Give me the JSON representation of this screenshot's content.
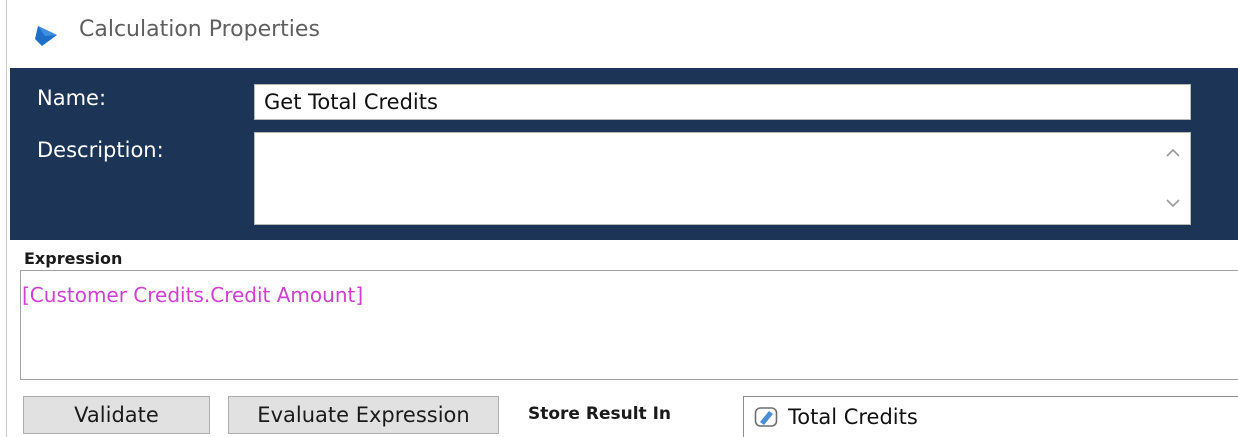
{
  "window": {
    "title": "Calculation Properties",
    "icon": "app-logo-icon"
  },
  "header": {
    "name_label": "Name:",
    "name_value": "Get Total Credits",
    "description_label": "Description:",
    "description_value": "",
    "background_color": "#1c3557"
  },
  "expression": {
    "label": "Expression",
    "value": "[Customer Credits.Credit Amount]",
    "text_color": "#d13ed3"
  },
  "actions": {
    "validate_label": "Validate",
    "evaluate_label": "Evaluate Expression"
  },
  "store": {
    "label": "Store Result In",
    "value": "Total Credits",
    "icon": "variable-icon"
  }
}
